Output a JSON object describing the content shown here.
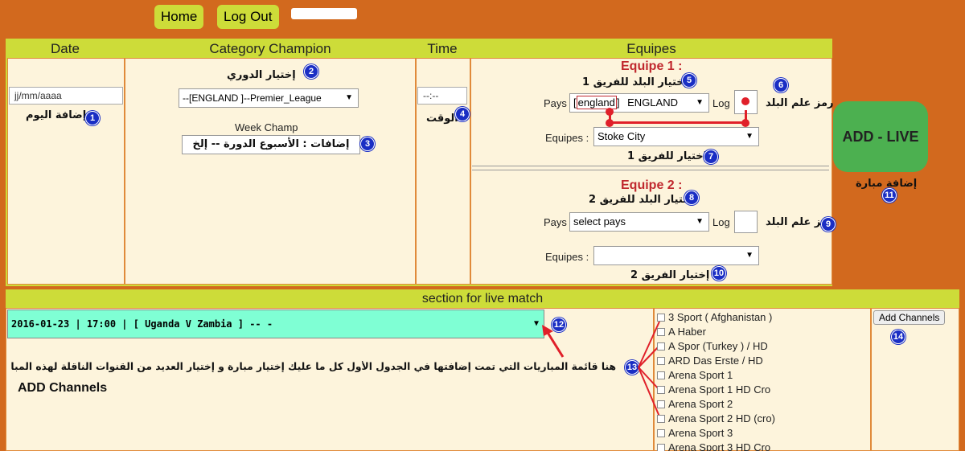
{
  "nav": {
    "home": "Home",
    "logout": "Log Out"
  },
  "headers": {
    "date": "Date",
    "category": "Category Champion",
    "time": "Time",
    "equipes": "Equipes"
  },
  "date": {
    "placeholder": "jj/mm/aaaa",
    "note": "إضافة اليوم"
  },
  "category": {
    "league_label": "إختيار الدوري",
    "league_value": "--[ENGLAND ]--Premier_League",
    "week_label": "Week Champ",
    "week_value": "إضافات : الأسبوع الدورة -- إلخ"
  },
  "time": {
    "placeholder": "--:--",
    "note": "الوقت"
  },
  "team1": {
    "title": "Equipe 1 :",
    "country_note": "إختيار البلد للفريق 1",
    "pays_label": "Pays",
    "pays_code": "england",
    "pays_value": "ENGLAND",
    "log_label": "Log",
    "flag_note": "رمز علم البلد",
    "equipes_label": "Equipes :",
    "team_value": "Stoke City",
    "team_note": "إختيار للفريق 1"
  },
  "team2": {
    "title": "Equipe 2 :",
    "country_note": "إختيار البلد للفريق 2",
    "pays_label": "Pays",
    "pays_value": "select pays",
    "log_label": "Log",
    "flag_note": "رمز علم البلد",
    "equipes_label": "Equipes :",
    "team_value": "",
    "team_note": "إختيار الفريق 2"
  },
  "add_live": {
    "label": "ADD - LIVE",
    "note": "إضافة مبارة"
  },
  "live_section": {
    "title": "section for live match",
    "match_value": "2016-01-23 | 17:00 | [ Uganda V Zambia ] -- -",
    "instructions": "هنا قائمة المباريات التي تمت إضافتها في الجدول الأول كل ما عليك إختيار مبارة و إختيار العديد من القنوات الناقلة لهذه المبارة وبعدها إضغط",
    "add_channels_text": "ADD Channels",
    "add_channels_button": "Add Channels",
    "channels": [
      "3 Sport ( Afghanistan )",
      "A Haber",
      "A Spor (Turkey ) / HD",
      "ARD Das Erste / HD",
      "Arena Sport 1",
      "Arena Sport 1 HD Cro",
      "Arena Sport 2",
      "Arena Sport 2 HD (cro)",
      "Arena Sport 3",
      "Arena Sport 3 HD Cro"
    ]
  },
  "badges": [
    "1",
    "2",
    "3",
    "4",
    "5",
    "6",
    "7",
    "8",
    "9",
    "10",
    "11",
    "12",
    "13",
    "14"
  ],
  "colors": {
    "background": "#d2691e",
    "header": "#cddc39",
    "panel": "#fdf4dc",
    "accent_red": "#c0282e",
    "badge_blue": "#1a2ec4",
    "add_live_green": "#4cb050",
    "match_select": "#7fffd4"
  }
}
